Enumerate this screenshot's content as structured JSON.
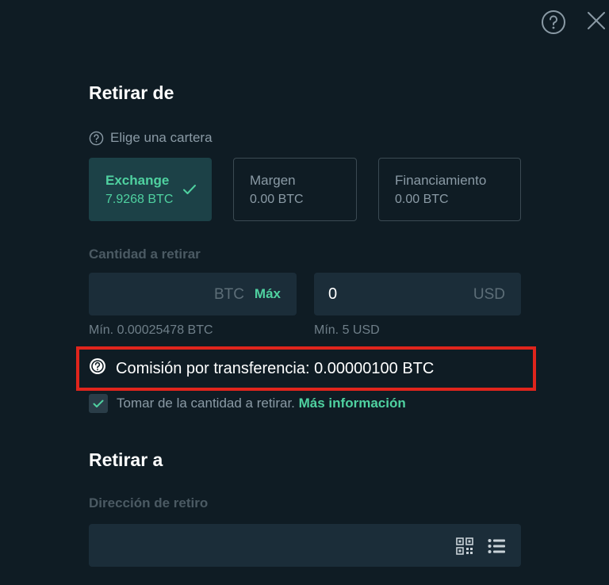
{
  "header": {
    "help_icon": "question-circle-icon",
    "close_icon": "close-icon"
  },
  "withdraw_from": {
    "title": "Retirar de",
    "wallet_prompt": "Elige una cartera",
    "wallets": [
      {
        "name": "Exchange",
        "balance": "7.9268 BTC",
        "selected": true
      },
      {
        "name": "Margen",
        "balance": "0.00 BTC",
        "selected": false
      },
      {
        "name": "Financiamiento",
        "balance": "0.00 BTC",
        "selected": false
      }
    ]
  },
  "amount": {
    "label": "Cantidad a retirar",
    "btc_currency": "BTC",
    "max_label": "Máx",
    "usd_value": "0",
    "usd_currency": "USD",
    "min_btc": "Mín. 0.00025478 BTC",
    "min_usd": "Mín. 5 USD"
  },
  "fee": {
    "text": "Comisión por transferencia: 0.00000100 BTC",
    "highlight_color": "#e0251c"
  },
  "take_from_amount": {
    "checked": true,
    "text": "Tomar de la cantidad a retirar.",
    "link": "Más información"
  },
  "withdraw_to": {
    "title": "Retirar a",
    "address_label": "Dirección de retiro",
    "address_value": "",
    "qr_icon": "qr-code-icon",
    "list_icon": "address-list-icon"
  },
  "colors": {
    "background": "#0f1c24",
    "accent": "#4fd1a0",
    "input_bg": "#1b2d39"
  }
}
